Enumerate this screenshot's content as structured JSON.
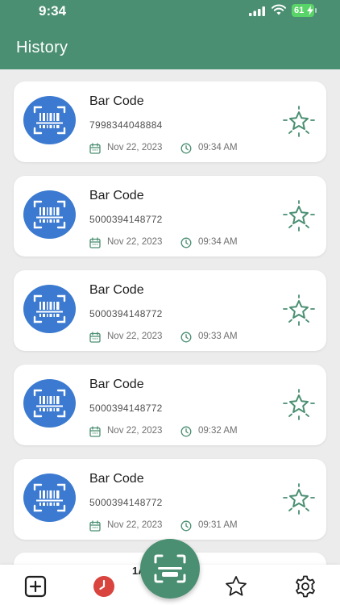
{
  "status_bar": {
    "time": "9:34",
    "battery": "61"
  },
  "header": {
    "title": "History"
  },
  "history": [
    {
      "title": "Bar Code",
      "code": "7998344048884",
      "date": "Nov 22, 2023",
      "time": "09:34 AM"
    },
    {
      "title": "Bar Code",
      "code": "5000394148772",
      "date": "Nov 22, 2023",
      "time": "09:34 AM"
    },
    {
      "title": "Bar Code",
      "code": "5000394148772",
      "date": "Nov 22, 2023",
      "time": "09:33 AM"
    },
    {
      "title": "Bar Code",
      "code": "5000394148772",
      "date": "Nov 22, 2023",
      "time": "09:32 AM"
    },
    {
      "title": "Bar Code",
      "code": "5000394148772",
      "date": "Nov 22, 2023",
      "time": "09:31 AM"
    }
  ],
  "bottom_nav": {
    "partial_label": "1A",
    "items": [
      {
        "icon": "add-square-icon"
      },
      {
        "icon": "history-clock-icon"
      },
      {
        "icon": "scan-icon"
      },
      {
        "icon": "star-icon"
      },
      {
        "icon": "gear-icon"
      }
    ]
  },
  "colors": {
    "primary": "#4a8f72",
    "icon_blue": "#3b7ad0",
    "history_red": "#d9443f",
    "background": "#ececec"
  }
}
